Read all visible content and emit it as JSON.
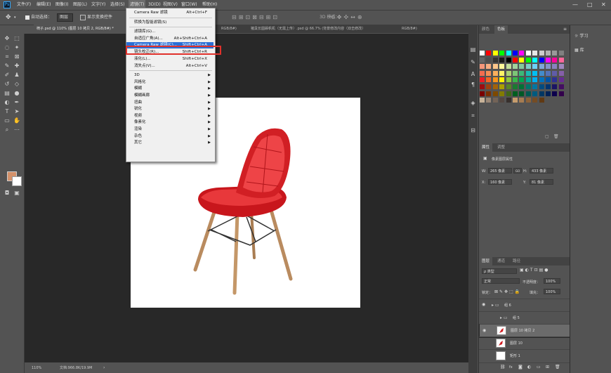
{
  "app": {
    "logo": "Ps"
  },
  "menubar": {
    "items": [
      "文件(F)",
      "编辑(E)",
      "图像(I)",
      "图层(L)",
      "文字(Y)",
      "选择(S)",
      "滤镜(T)",
      "3D(D)",
      "视图(V)",
      "窗口(W)",
      "帮助(H)"
    ],
    "active": "滤镜(T)",
    "window_controls": [
      "—",
      "□",
      "✕"
    ]
  },
  "options_bar": {
    "auto_select_label": "自动选择：",
    "auto_select_value": "图层",
    "show_transform_label": "显示变换控件",
    "mode3d_label": "3D 模式："
  },
  "tabs": [
    {
      "label": "椅子.psd @ 110% (图层 10 拷贝 2, RGB/8#) *",
      "active": true
    },
    {
      "label": "RGB/8#)",
      "active": false
    },
    {
      "label": "猪臭长圆舔帆机（无需上传）.psd @ 66.7% (背景修改内容（双击修改）",
      "active": false
    },
    {
      "label": "RGB/8#)",
      "active": false
    }
  ],
  "filter_menu": {
    "items": [
      {
        "label": "Camera Raw 滤镜",
        "shortcut": "Alt+Ctrl+F"
      },
      {
        "sep": true
      },
      {
        "label": "转换为智能滤镜(S)",
        "shortcut": ""
      },
      {
        "sep": true
      },
      {
        "label": "滤镜库(G)...",
        "shortcut": ""
      },
      {
        "label": "自适应广角(A)...",
        "shortcut": "Alt+Shift+Ctrl+A"
      },
      {
        "label": "Camera Raw 滤镜(C)...",
        "shortcut": "Shift+Ctrl+A",
        "highlighted": true
      },
      {
        "label": "镜头校正(R)...",
        "shortcut": "Shift+Ctrl+R"
      },
      {
        "label": "液化(L)...",
        "shortcut": "Shift+Ctrl+X"
      },
      {
        "label": "消失点(V)...",
        "shortcut": "Alt+Ctrl+V"
      },
      {
        "sep": true
      },
      {
        "label": "3D",
        "submenu": true
      },
      {
        "label": "风格化",
        "submenu": true
      },
      {
        "label": "模糊",
        "submenu": true
      },
      {
        "label": "模糊画廊",
        "submenu": true
      },
      {
        "label": "扭曲",
        "submenu": true
      },
      {
        "label": "锐化",
        "submenu": true
      },
      {
        "label": "视频",
        "submenu": true
      },
      {
        "label": "像素化",
        "submenu": true
      },
      {
        "label": "渲染",
        "submenu": true
      },
      {
        "label": "杂色",
        "submenu": true
      },
      {
        "label": "其它",
        "submenu": true
      }
    ]
  },
  "status_bar": {
    "zoom": "110%",
    "doc_info": "文档:966.8K/19.9M"
  },
  "swatches_panel": {
    "tabs": [
      "颜色",
      "色板"
    ],
    "active": "色板",
    "colors": [
      "#ffffff",
      "#ff0000",
      "#ffff00",
      "#00ff00",
      "#00ffff",
      "#0000ff",
      "#ff00ff",
      "#ffffff",
      "#e6e6e6",
      "#cccccc",
      "#b3b3b3",
      "#999999",
      "#808080",
      "#666666",
      "#4d4d4d",
      "#333333",
      "#1a1a1a",
      "#000000",
      "#ff0000",
      "#ffff00",
      "#00ff00",
      "#00ffff",
      "#0000ff",
      "#ff00ff",
      "#ff0099",
      "#ff6699",
      "#f7977a",
      "#f9ad81",
      "#fdc68a",
      "#fff79a",
      "#c4df9b",
      "#a2d39c",
      "#82ca9d",
      "#7bcdc8",
      "#6ecff6",
      "#7ea7d8",
      "#8493ca",
      "#8882be",
      "#a187be",
      "#f26c4f",
      "#f68e55",
      "#fbaf5c",
      "#fff467",
      "#acd372",
      "#7cc576",
      "#3bb878",
      "#1abbb4",
      "#00bff3",
      "#438ccb",
      "#5574b9",
      "#605ca8",
      "#855fa8",
      "#ed1c24",
      "#f26522",
      "#f7941d",
      "#fff200",
      "#8dc73f",
      "#39b54a",
      "#00a651",
      "#00a99d",
      "#00aeef",
      "#0072bc",
      "#0054a6",
      "#2e3192",
      "#662d91",
      "#9e0b0f",
      "#a0410d",
      "#a36209",
      "#aba000",
      "#598527",
      "#1a7b30",
      "#007236",
      "#00746b",
      "#0076a3",
      "#004b80",
      "#003471",
      "#1b1464",
      "#440e62",
      "#790000",
      "#7b2e00",
      "#7d4900",
      "#827b00",
      "#406618",
      "#005e20",
      "#005826",
      "#005952",
      "#005b7f",
      "#003663",
      "#002157",
      "#0d004c",
      "#32004b",
      "#c7b299",
      "#998675",
      "#736357",
      "#534741",
      "#37302d",
      "#c69c6d",
      "#a67c52",
      "#8c6239",
      "#754c24",
      "#603913"
    ]
  },
  "properties_panel": {
    "tabs": [
      "属性",
      "调整"
    ],
    "active": "属性",
    "title": "像素图层属性",
    "w_label": "W:",
    "w": "265 像素",
    "link_label": "GO",
    "h_label": "H:",
    "h": "433 像素",
    "x_label": "X:",
    "x": "160 像素",
    "y_label": "Y:",
    "y": "81 像素"
  },
  "layers_panel": {
    "tabs": [
      "图层",
      "通道",
      "路径"
    ],
    "active": "图层",
    "filter": "ρ 类型",
    "blend_mode": "正常",
    "opacity_label": "不透明度：",
    "opacity": "100%",
    "lock_label": "锁定：",
    "fill_label": "填充：",
    "fill": "100%",
    "layers": [
      {
        "name": "组 6",
        "type": "group",
        "eye": true,
        "selected": false
      },
      {
        "name": "组 5",
        "type": "group",
        "eye": false,
        "selected": false
      },
      {
        "name": "图层 10 拷贝 2",
        "type": "chair",
        "eye": true,
        "selected": true
      },
      {
        "name": "图层 10",
        "type": "chair",
        "eye": false,
        "selected": false
      },
      {
        "name": "矩形 1",
        "type": "rect",
        "eye": false,
        "selected": false
      }
    ],
    "footer_icons": [
      "link-icon",
      "fx-icon",
      "mask-icon",
      "adjustment-icon",
      "folder-icon",
      "new-layer-icon",
      "trash-icon"
    ]
  },
  "right_dock": {
    "items": [
      {
        "label": "学习",
        "icon": "lightbulb-icon"
      },
      {
        "label": "库",
        "icon": "library-icon"
      }
    ]
  }
}
